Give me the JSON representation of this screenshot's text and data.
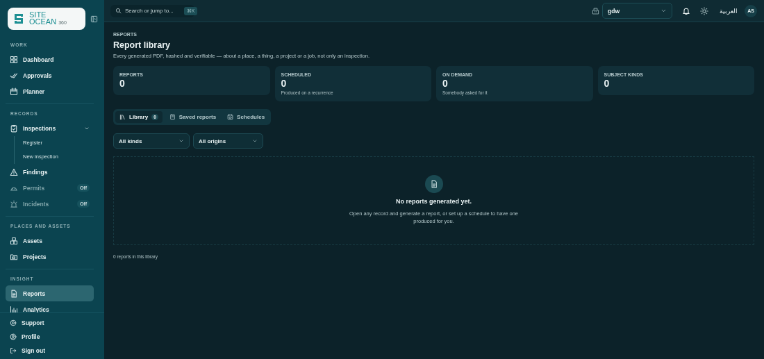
{
  "sidebar": {
    "logo": {
      "line_1": "SITE",
      "line_2": "OCEAN",
      "suffix": "360"
    },
    "sections": [
      {
        "label": "WORK",
        "items": [
          {
            "label": "Dashboard",
            "selected": false,
            "disabled": false
          },
          {
            "label": "Approvals",
            "selected": false,
            "disabled": false
          },
          {
            "label": "Planner",
            "selected": false,
            "disabled": false
          }
        ]
      },
      {
        "label": "RECORDS",
        "items": [
          {
            "label": "Inspections",
            "selected": false,
            "disabled": false,
            "expanded": true,
            "children": [
              {
                "label": "Register",
                "selected": false
              },
              {
                "label": "New inspection",
                "selected": false
              }
            ]
          },
          {
            "label": "Findings",
            "selected": false,
            "disabled": false
          },
          {
            "label": "Permits",
            "selected": false,
            "disabled": true,
            "badge": "Off"
          },
          {
            "label": "Incidents",
            "selected": false,
            "disabled": true,
            "badge": "Off"
          }
        ]
      },
      {
        "label": "PLACES AND ASSETS",
        "items": [
          {
            "label": "Assets",
            "selected": false,
            "disabled": false
          },
          {
            "label": "Projects",
            "selected": false,
            "disabled": false
          }
        ]
      },
      {
        "label": "INSIGHT",
        "items": [
          {
            "label": "Reports",
            "selected": true,
            "disabled": false
          },
          {
            "label": "Analytics",
            "selected": false,
            "disabled": false
          }
        ]
      }
    ],
    "footer": [
      "Support",
      "Profile",
      "Sign out"
    ]
  },
  "topbar": {
    "search": {
      "placeholder": "Search or jump to...",
      "shortcut": "⌘K"
    },
    "workspace": "gdw",
    "language": "العربية",
    "avatar": "AS"
  },
  "page": {
    "eyebrow": "REPORTS",
    "title": "Report library",
    "description": "Every generated PDF, hashed and verifiable — about a place, a thing, a project or a job, not only an inspection.",
    "stats": [
      {
        "label": "REPORTS",
        "value": "0"
      },
      {
        "label": "SCHEDULED",
        "value": "0",
        "note": "Produced on a recurrence"
      },
      {
        "label": "ON DEMAND",
        "value": "0",
        "note": "Somebody asked for it"
      },
      {
        "label": "SUBJECT KINDS",
        "value": "0"
      }
    ],
    "tabs": [
      {
        "label": "Library",
        "count": "0",
        "selected": true
      },
      {
        "label": "Saved reports",
        "selected": false
      },
      {
        "label": "Schedules",
        "selected": false
      }
    ],
    "filters": [
      {
        "value": "All kinds"
      },
      {
        "value": "All origins"
      }
    ],
    "empty_state": {
      "title": "No reports generated yet.",
      "text": "Open any record and generate a report, or set up a schedule to have one produced for you."
    },
    "footer_count": "0 reports in this library"
  }
}
